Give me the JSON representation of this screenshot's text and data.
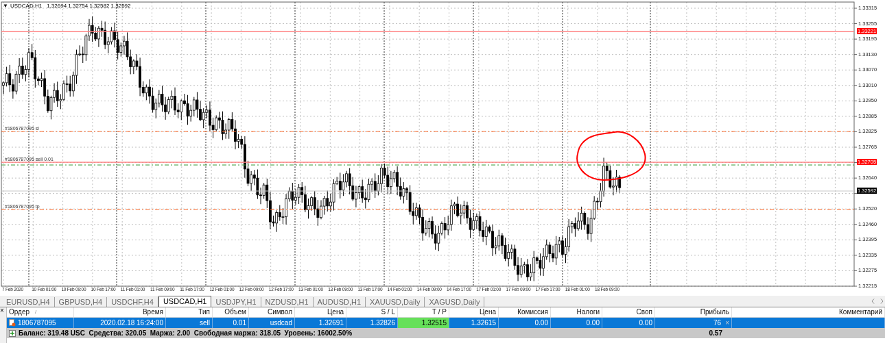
{
  "chart": {
    "collapse_glyph": "▼",
    "symbol": "USDCAD,H1",
    "ohlc": "1.32694 1.32754 1.32582 1.32592",
    "price_labels": [
      "1.33315",
      "1.33255",
      "1.33195",
      "1.33130",
      "1.33070",
      "1.33010",
      "1.32950",
      "1.32885",
      "1.32825",
      "1.32765",
      "1.32640",
      "1.32520",
      "1.32460",
      "1.32395",
      "1.32335",
      "1.32275",
      "1.32215"
    ],
    "price_markers": [
      {
        "label": "1.33221",
        "color": "#ff0000"
      },
      {
        "label": "1.32705",
        "color": "#ff0000"
      },
      {
        "label": "1.32592",
        "color": "#000000"
      }
    ],
    "order_lines": [
      {
        "label": "#1806787095 sl",
        "kind": "sl"
      },
      {
        "label": "#1806787095 sell 0.01",
        "kind": "entry"
      },
      {
        "label": "#1806787095 tp",
        "kind": "tp"
      }
    ],
    "time_labels": [
      "7 Feb 2020",
      "10 Feb 01:00",
      "10 Feb 09:00",
      "10 Feb 17:00",
      "11 Feb 01:00",
      "11 Feb 09:00",
      "11 Feb 17:00",
      "12 Feb 01:00",
      "12 Feb 09:00",
      "12 Feb 17:00",
      "13 Feb 01:00",
      "13 Feb 09:00",
      "13 Feb 17:00",
      "14 Feb 01:00",
      "14 Feb 09:00",
      "14 Feb 17:00",
      "17 Feb 01:00",
      "17 Feb 09:00",
      "17 Feb 17:00",
      "18 Feb 01:00",
      "18 Feb 09:00"
    ]
  },
  "tabs": [
    {
      "label": "EURUSD,H4",
      "selected": false
    },
    {
      "label": "GBPUSD,H4",
      "selected": false
    },
    {
      "label": "USDCHF,H4",
      "selected": false
    },
    {
      "label": "USDCAD,H1",
      "selected": true
    },
    {
      "label": "USDJPY,H1",
      "selected": false
    },
    {
      "label": "NZDUSD,H1",
      "selected": false
    },
    {
      "label": "AUDUSD,H1",
      "selected": false
    },
    {
      "label": "XAUUSD,Daily",
      "selected": false
    },
    {
      "label": "XAGUSD,Daily",
      "selected": false
    }
  ],
  "table": {
    "columns": [
      "Ордер",
      "Время",
      "Тип",
      "Объем",
      "Символ",
      "Цена",
      "S / L",
      "T / P",
      "Цена",
      "Комиссия",
      "Налоги",
      "Своп",
      "Прибыль",
      "Комментарий"
    ],
    "sort_mark": "/",
    "panel_close_glyph": "×",
    "rows": [
      {
        "selected": true,
        "cells": [
          "1806787095",
          "2020.02.18 16:24:00",
          "sell",
          "0.01",
          "usdcad",
          "1.32691",
          "1.32826",
          "1.32515",
          "1.32615",
          "0.00",
          "0.00",
          "0.00",
          "76"
        ],
        "close_glyph": "×"
      }
    ],
    "balance": {
      "text": "Баланс: 319.48 USC  Средства: 320.05  Маржа: 2.00  Свободная маржа: 318.05  Уровень: 16002.50%",
      "profit": "0.57"
    }
  }
}
